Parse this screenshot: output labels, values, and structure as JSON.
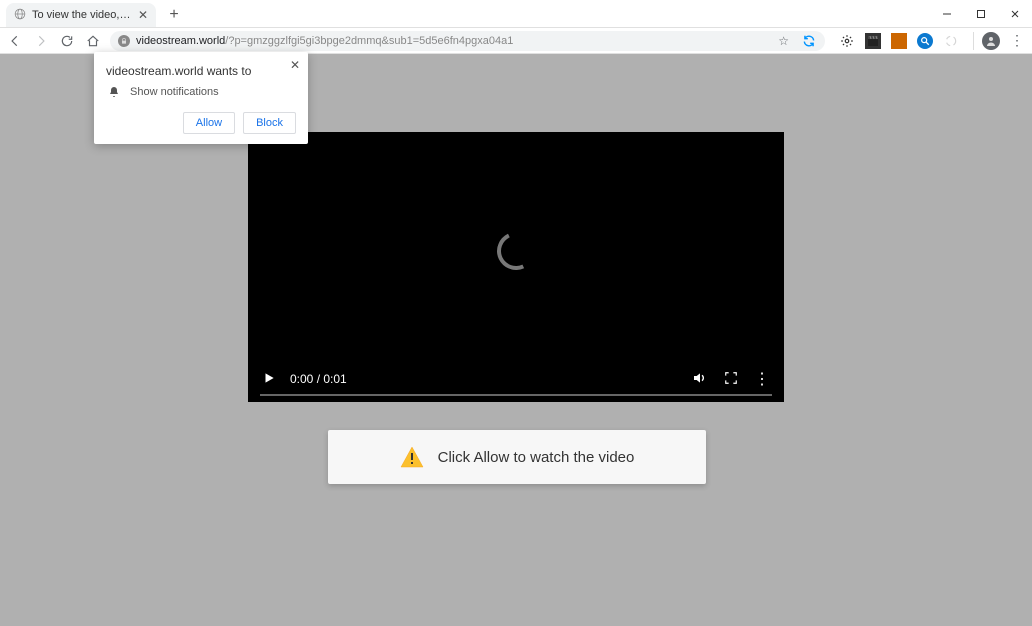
{
  "browser": {
    "tab": {
      "title": "To view the video, click the Allow"
    },
    "url": {
      "host": "videostream.world",
      "path": "/?p=gmzggzlfgi5gi3bpge2dmmq&sub1=5d5e6fn4pgxa04a1"
    }
  },
  "permission_prompt": {
    "title": "videostream.world wants to",
    "permission_label": "Show notifications",
    "allow": "Allow",
    "block": "Block"
  },
  "video": {
    "time": "0:00 / 0:01"
  },
  "banner": {
    "text": "Click Allow to watch the video"
  }
}
